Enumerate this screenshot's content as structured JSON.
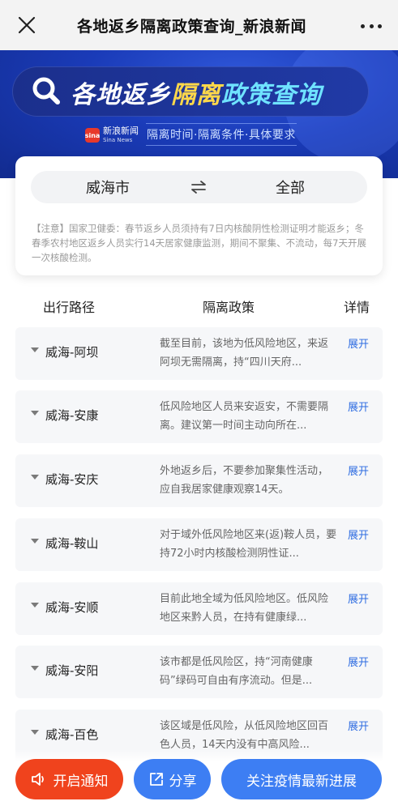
{
  "nav": {
    "title": "各地返乡隔离政策查询_新浪新闻"
  },
  "banner": {
    "title_part1": "各地返乡",
    "title_part2": "隔离",
    "title_part3": "政策查询",
    "sina_name": "新浪新闻",
    "sina_en": "Sina News",
    "subtitle": "隔离时间·隔离条件·具体要求"
  },
  "selector": {
    "city": "威海市",
    "scope": "全部",
    "note": "【注意】国家卫健委：春节返乡人员须持有7日内核酸阴性检测证明才能返乡；冬春季农村地区返乡人员实行14天居家健康监测，期间不聚集、不流动，每7天开展一次核酸检测。"
  },
  "columns": {
    "route": "出行路径",
    "policy": "隔离政策",
    "detail": "详情"
  },
  "rows": [
    {
      "route": "威海-阿坝",
      "policy": "截至目前，该地为低风险地区，来返阿坝无需隔离，持“四川天府...",
      "expand": "展开"
    },
    {
      "route": "威海-安康",
      "policy": "低风险地区人员来安返安，不需要隔离。建议第一时间主动向所在...",
      "expand": "展开"
    },
    {
      "route": "威海-安庆",
      "policy": "外地返乡后，不要参加聚集性活动，应自我居家健康观察14天。",
      "expand": "展开"
    },
    {
      "route": "威海-鞍山",
      "policy": "对于域外低风险地区来(返)鞍人员，要持72小时内核酸检测阴性证...",
      "expand": "展开"
    },
    {
      "route": "威海-安顺",
      "policy": "目前此地全域为低风险地区。低风险地区来黔人员，在持有健康绿...",
      "expand": "展开"
    },
    {
      "route": "威海-安阳",
      "policy": "该市都是低风险区，持“河南健康码”绿码可自由有序流动。但是...",
      "expand": "展开"
    },
    {
      "route": "威海-百色",
      "policy": "该区域是低风险，从低风险地区回百色人员，14天内没有中高风险...",
      "expand": "展开"
    }
  ],
  "bottom": {
    "notify": "开启通知",
    "share": "分享",
    "follow": "关注疫情最新进展"
  },
  "colors": {
    "accent_blue": "#3d7ef3",
    "notify_red": "#f0431d",
    "link_blue": "#2f6de1"
  }
}
